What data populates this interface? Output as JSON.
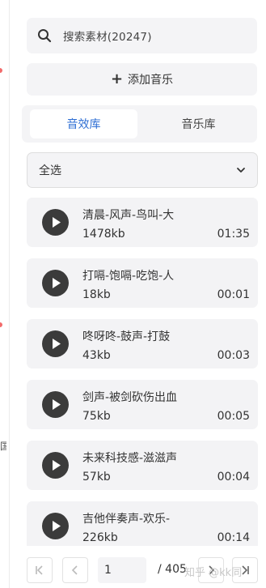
{
  "search": {
    "placeholder": "搜索素材(20247)"
  },
  "add_music": {
    "label": "添加音乐"
  },
  "tabs": [
    {
      "label": "音效库",
      "active": true
    },
    {
      "label": "音乐库",
      "active": false
    }
  ],
  "filter": {
    "selected": "全选"
  },
  "items": [
    {
      "name": "清晨-风声-鸟叫-大",
      "size": "1478kb",
      "duration": "01:35"
    },
    {
      "name": "打嗝-饱嗝-吃饱-人",
      "size": "18kb",
      "duration": "00:01"
    },
    {
      "name": "咚呀咚-鼓声-打鼓",
      "size": "43kb",
      "duration": "00:03"
    },
    {
      "name": "剑声-被剑砍伤出血",
      "size": "75kb",
      "duration": "00:05"
    },
    {
      "name": "未来科技感-滋滋声",
      "size": "57kb",
      "duration": "00:04"
    },
    {
      "name": "吉他伴奏声-欢乐-",
      "size": "226kb",
      "duration": "00:14"
    }
  ],
  "pagination": {
    "current": "1",
    "total": "/ 405"
  },
  "watermark": "知乎 @kk同",
  "edge_text": "国",
  "colors": {
    "accent": "#2f6fd4",
    "panel_bg": "#f4f4f6",
    "play_bg": "#3b3b3b"
  }
}
